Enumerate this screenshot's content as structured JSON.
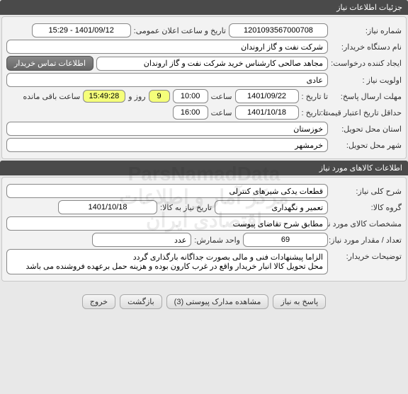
{
  "section1": {
    "title": "جزئیات اطلاعات نیاز"
  },
  "need": {
    "number_label": "شماره نیاز:",
    "number": "1201093567000708",
    "announce_label": "تاریخ و ساعت اعلان عمومی:",
    "announce": "1401/09/12 - 15:29",
    "buyer_label": "نام دستگاه خریدار:",
    "buyer": "شرکت نفت و گاز اروندان",
    "creator_label": "ایجاد کننده درخواست:",
    "creator": "مجاهد صالحی کارشناس خرید شرکت نفت و گاز اروندان",
    "contact_btn": "اطلاعات تماس خریدار",
    "priority_label": "اولویت نیاز :",
    "priority": "عادی",
    "deadline_label": "مهلت ارسال پاسخ:",
    "to_date_label": "تا تاریخ :",
    "deadline_date": "1401/09/22",
    "time_label": "ساعت",
    "deadline_time": "10:00",
    "days": "9",
    "days_label": "روز و",
    "countdown": "15:49:28",
    "remain_label": "ساعت باقی مانده",
    "price_valid_label": "حداقل تاریخ اعتبار قیمت:",
    "price_valid_date": "1401/10/18",
    "price_valid_time": "16:00",
    "province_label": "استان محل تحویل:",
    "province": "خوزستان",
    "city_label": "شهر محل تحویل:",
    "city": "خرمشهر"
  },
  "section2": {
    "title": "اطلاعات کالاهای مورد نیاز"
  },
  "goods": {
    "desc_label": "شرح کلی نیاز:",
    "desc": "قطعات یدکی شیرهای کنترلی",
    "group_label": "گروه کالا:",
    "group": "تعمیر و نگهداری",
    "need_date_label": "تاریخ نیاز به کالا:",
    "need_date": "1401/10/18",
    "spec_label": "مشخصات کالای مورد نیاز:",
    "spec": "مطابق شرح تقاضای پیوست",
    "qty_label": "تعداد / مقدار مورد نیاز:",
    "qty": "69",
    "unit_label": "واحد شمارش:",
    "unit": "عدد",
    "notes_label": "توضیحات خریدار:",
    "notes_line1": "الزاما  پیشنهادات فنی و مالی بصورت جداگانه بارگذاری گردد",
    "notes_line2": "محل تحویل کالا انبار خریدار واقع در غرب کارون بوده و هزینه حمل برعهده فروشنده می باشد"
  },
  "buttons": {
    "respond": "پاسخ به نیاز",
    "attachments": "مشاهده مدارک پیوستی (3)",
    "back": "بازگشت",
    "exit": "خروج"
  },
  "watermark": "ParsNamadData\nمرکز آمار و اطلاعات اقتصادی ایران"
}
